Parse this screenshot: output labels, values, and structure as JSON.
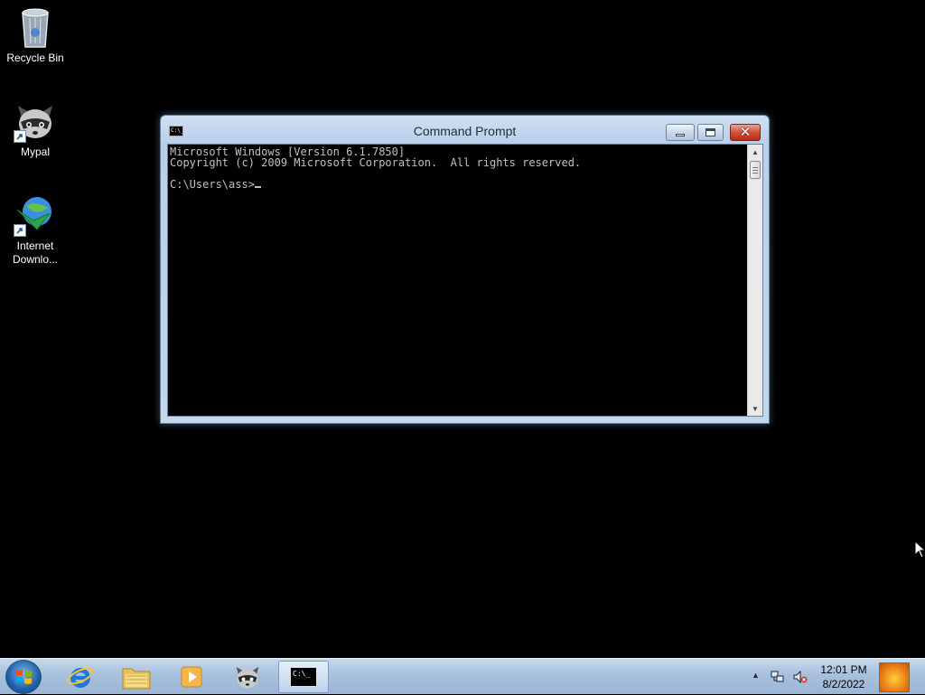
{
  "desktop": {
    "icons": [
      {
        "label": "Recycle Bin",
        "icon": "recycle-bin-icon"
      },
      {
        "label": "Mypal",
        "icon": "mypal-raccoon-icon"
      },
      {
        "label": "Internet Downlo...",
        "icon": "internet-download-manager-icon"
      }
    ]
  },
  "window": {
    "title": "Command Prompt",
    "console_lines": [
      "Microsoft Windows [Version 6.1.7850]",
      "Copyright (c) 2009 Microsoft Corporation.  All rights reserved.",
      "",
      "C:\\Users\\ass>"
    ]
  },
  "taskbar": {
    "start_icon": "windows-start-orb",
    "pinned": [
      {
        "name": "internet-explorer",
        "icon": "internet-explorer-icon"
      },
      {
        "name": "windows-explorer",
        "icon": "folder-icon"
      },
      {
        "name": "media-player",
        "icon": "media-player-icon"
      },
      {
        "name": "mypal",
        "icon": "mypal-raccoon-icon"
      },
      {
        "name": "command-prompt",
        "icon": "cmd-icon",
        "active": true
      }
    ],
    "cmd_icon_text": "C:\\_",
    "clock": {
      "time": "12:01 PM",
      "date": "8/2/2022"
    }
  },
  "colors": {
    "desktop_bg": "#000000",
    "console_fg": "#c0c0c0",
    "close_button": "#c8452f",
    "taskbar": "#a7c0dc"
  }
}
